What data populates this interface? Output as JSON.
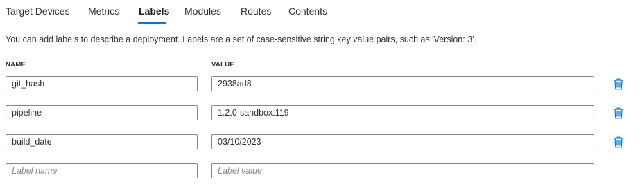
{
  "tabs": [
    {
      "label": "Target Devices",
      "active": false
    },
    {
      "label": "Metrics",
      "active": false
    },
    {
      "label": "Labels",
      "active": true
    },
    {
      "label": "Modules",
      "active": false
    },
    {
      "label": "Routes",
      "active": false
    },
    {
      "label": "Contents",
      "active": false
    }
  ],
  "description": "You can add labels to describe a deployment. Labels are a set of case-sensitive string key value pairs, such as 'Version: 3'.",
  "columns": {
    "name": "NAME",
    "value": "VALUE"
  },
  "labels": [
    {
      "name": "git_hash",
      "value": "2938ad8"
    },
    {
      "name": "pipeline",
      "value": "1.2.0-sandbox.119"
    },
    {
      "name": "build_date",
      "value": "03/10/2023"
    }
  ],
  "new_label": {
    "name_placeholder": "Label name",
    "value_placeholder": "Label value"
  },
  "icons": {
    "delete": "trash-icon"
  },
  "colors": {
    "accent": "#0078d4",
    "border": "#8a8886",
    "text": "#323130",
    "placeholder": "#8a8886"
  }
}
